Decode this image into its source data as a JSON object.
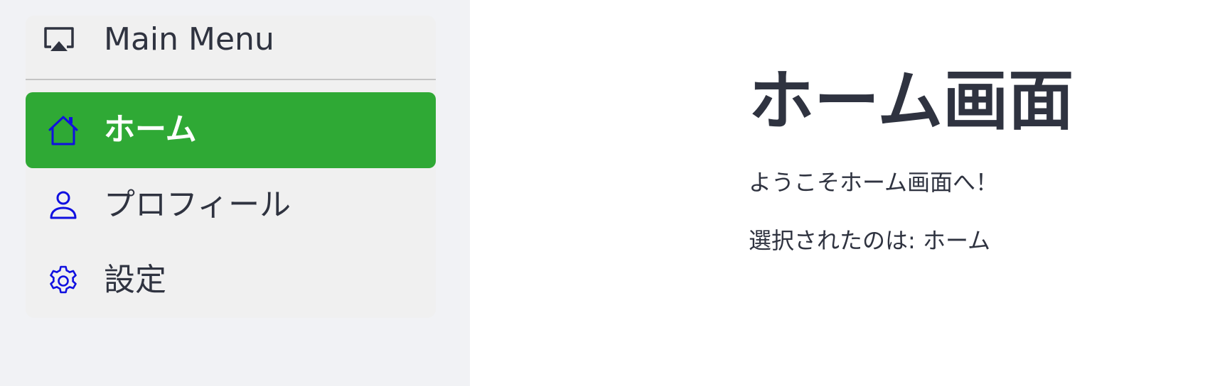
{
  "sidebar": {
    "header": {
      "label": "Main Menu",
      "icon": "airplay-icon"
    },
    "items": [
      {
        "label": "ホーム",
        "icon": "home-icon",
        "active": true
      },
      {
        "label": "プロフィール",
        "icon": "user-icon",
        "active": false
      },
      {
        "label": "設定",
        "icon": "gear-icon",
        "active": false
      }
    ]
  },
  "main": {
    "title": "ホーム画面",
    "welcome": "ようこそホーム画面へ！",
    "selected_prefix": "選択されたのは: ",
    "selected_value": "ホーム"
  },
  "colors": {
    "active_bg": "#2fa935",
    "icon": "#1010e0",
    "text": "#2f3340",
    "sidebar_bg": "#f1f2f5",
    "card_bg": "#f0f0f0"
  }
}
